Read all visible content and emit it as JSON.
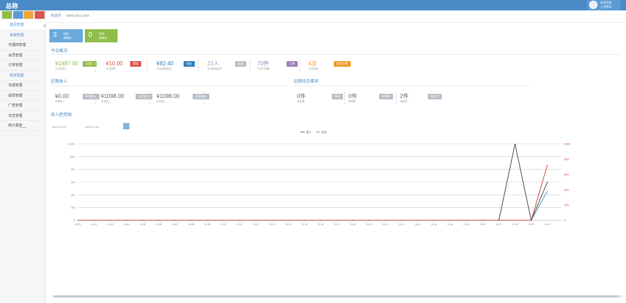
{
  "header": {
    "logo": "总称",
    "user_line1": "欢迎光临",
    "user_line2": "上次登录"
  },
  "sidebar": {
    "color_buttons": [
      "#8fbd4b",
      "#5b9bd3",
      "#f2a63b",
      "#d9534f"
    ],
    "items": [
      {
        "label": "首页管理",
        "kind": "group",
        "active": true
      },
      {
        "label": "系统管理",
        "kind": "group",
        "active": false
      },
      {
        "label": "代理商管理",
        "kind": "item",
        "active": false
      },
      {
        "label": "会员管理",
        "kind": "item",
        "active": false
      },
      {
        "label": "订单管理",
        "kind": "item",
        "active": false
      },
      {
        "label": "财务管理",
        "kind": "group",
        "active": false
      },
      {
        "label": "充值管理",
        "kind": "item",
        "active": false
      },
      {
        "label": "提现管理",
        "kind": "item",
        "active": false
      },
      {
        "label": "广告管理",
        "kind": "item",
        "active": false
      },
      {
        "label": "日志管理",
        "kind": "item",
        "active": false
      },
      {
        "label": "统计报表",
        "kind": "item",
        "active": false
      }
    ]
  },
  "breadcrumb": {
    "title": "欢迎页",
    "sub": "www.xxxx.com"
  },
  "tiles": [
    {
      "num": "3",
      "label1": "待处",
      "label2": "理事务",
      "color": "#6aa9da"
    },
    {
      "num": "0",
      "label1": "待审",
      "label2": "核事务",
      "color": "#8fbd4b"
    }
  ],
  "sections": {
    "overview": "今日概况",
    "income": "近期收入",
    "pending": "近期待办事项",
    "trend": "收入趋势图"
  },
  "overview_stats": [
    {
      "value": "¥1987.00",
      "sub": "今日总收入",
      "tag": "总收入",
      "tag_color": "#8fbd4b",
      "value_color": "#8fbd4b"
    },
    {
      "value": "¥10.00",
      "sub": "今日提现",
      "tag": "提现",
      "tag_color": "#d9534f",
      "value_color": "#d9534f"
    },
    {
      "value": "¥82.40",
      "sub": "今日佣金发放",
      "tag": "佣金",
      "tag_color": "#2f7fb8",
      "value_color": "#2f7fb8"
    },
    {
      "value": "23人",
      "sub": "今日新增会员",
      "tag": "会员",
      "tag_color": "#b7bec6",
      "value_color": "#8aa8c4"
    },
    {
      "value": "70件",
      "sub": "今日订单数",
      "tag": "订单",
      "tag_color": "#9b7fbf",
      "value_color": "#9b7fbf"
    },
    {
      "value": "4次",
      "sub": "今日登录",
      "tag": "登录次数",
      "tag_color": "#f0961e",
      "value_color": "#f0961e"
    }
  ],
  "income_stats": [
    {
      "value": "¥0.00",
      "sub": "本周收入",
      "tag": "本周收入"
    },
    {
      "value": "¥1098.00",
      "sub": "本月收入",
      "tag": "本月收入"
    },
    {
      "value": "¥1098.00",
      "sub": "本年收入",
      "tag": "本年收入"
    }
  ],
  "pending_stats": [
    {
      "value": "0件",
      "sub": "待处理",
      "tag": "待办"
    },
    {
      "value": "0件",
      "sub": "待审核",
      "tag": "待审核"
    },
    {
      "value": "2件",
      "sub": "待发货",
      "tag": "待发货"
    }
  ],
  "filters": {
    "start": "2023-01-01",
    "end": "2023-12-31"
  },
  "chart_data": {
    "type": "line",
    "legend": [
      "收入",
      "支出"
    ],
    "series_colors": [
      "#333333",
      "#4a8ac6",
      "#c0392b"
    ],
    "x": [
      "01-01",
      "01-02",
      "01-03",
      "01-04",
      "01-05",
      "01-06",
      "01-07",
      "01-08",
      "01-09",
      "01-10",
      "01-11",
      "01-12",
      "01-13",
      "01-14",
      "01-15",
      "01-16",
      "01-17",
      "01-18",
      "01-19",
      "01-20",
      "01-21",
      "01-22",
      "01-23",
      "01-24",
      "01-25",
      "01-26",
      "01-27",
      "01-28",
      "01-29",
      "01-30"
    ],
    "series": [
      {
        "name": "收入",
        "values": [
          0,
          0,
          0,
          0,
          0,
          0,
          0,
          0,
          0,
          0,
          0,
          0,
          0,
          0,
          0,
          0,
          0,
          0,
          0,
          0,
          0,
          0,
          0,
          0,
          0,
          0,
          0,
          1098,
          0,
          550
        ]
      },
      {
        "name": "支出",
        "values": [
          0,
          0,
          0,
          0,
          0,
          0,
          0,
          0,
          0,
          0,
          0,
          0,
          0,
          0,
          0,
          0,
          0,
          0,
          0,
          0,
          0,
          0,
          0,
          0,
          0,
          0,
          0,
          null,
          0,
          420
        ]
      }
    ],
    "red_series": [
      0,
      0,
      0,
      0,
      0,
      0,
      0,
      0,
      0,
      0,
      0,
      0,
      0,
      0,
      0,
      0,
      0,
      0,
      0,
      0,
      0,
      0,
      0,
      0,
      0,
      0,
      0,
      null,
      0,
      800
    ],
    "ylim": [
      0,
      1100
    ],
    "y_ticks": [
      "0",
      "200",
      "400",
      "600",
      "800",
      "1000",
      "¥1,000"
    ],
    "right_ticks": [
      "0",
      "20%",
      "40%",
      "60%",
      "80%",
      "100%"
    ]
  }
}
